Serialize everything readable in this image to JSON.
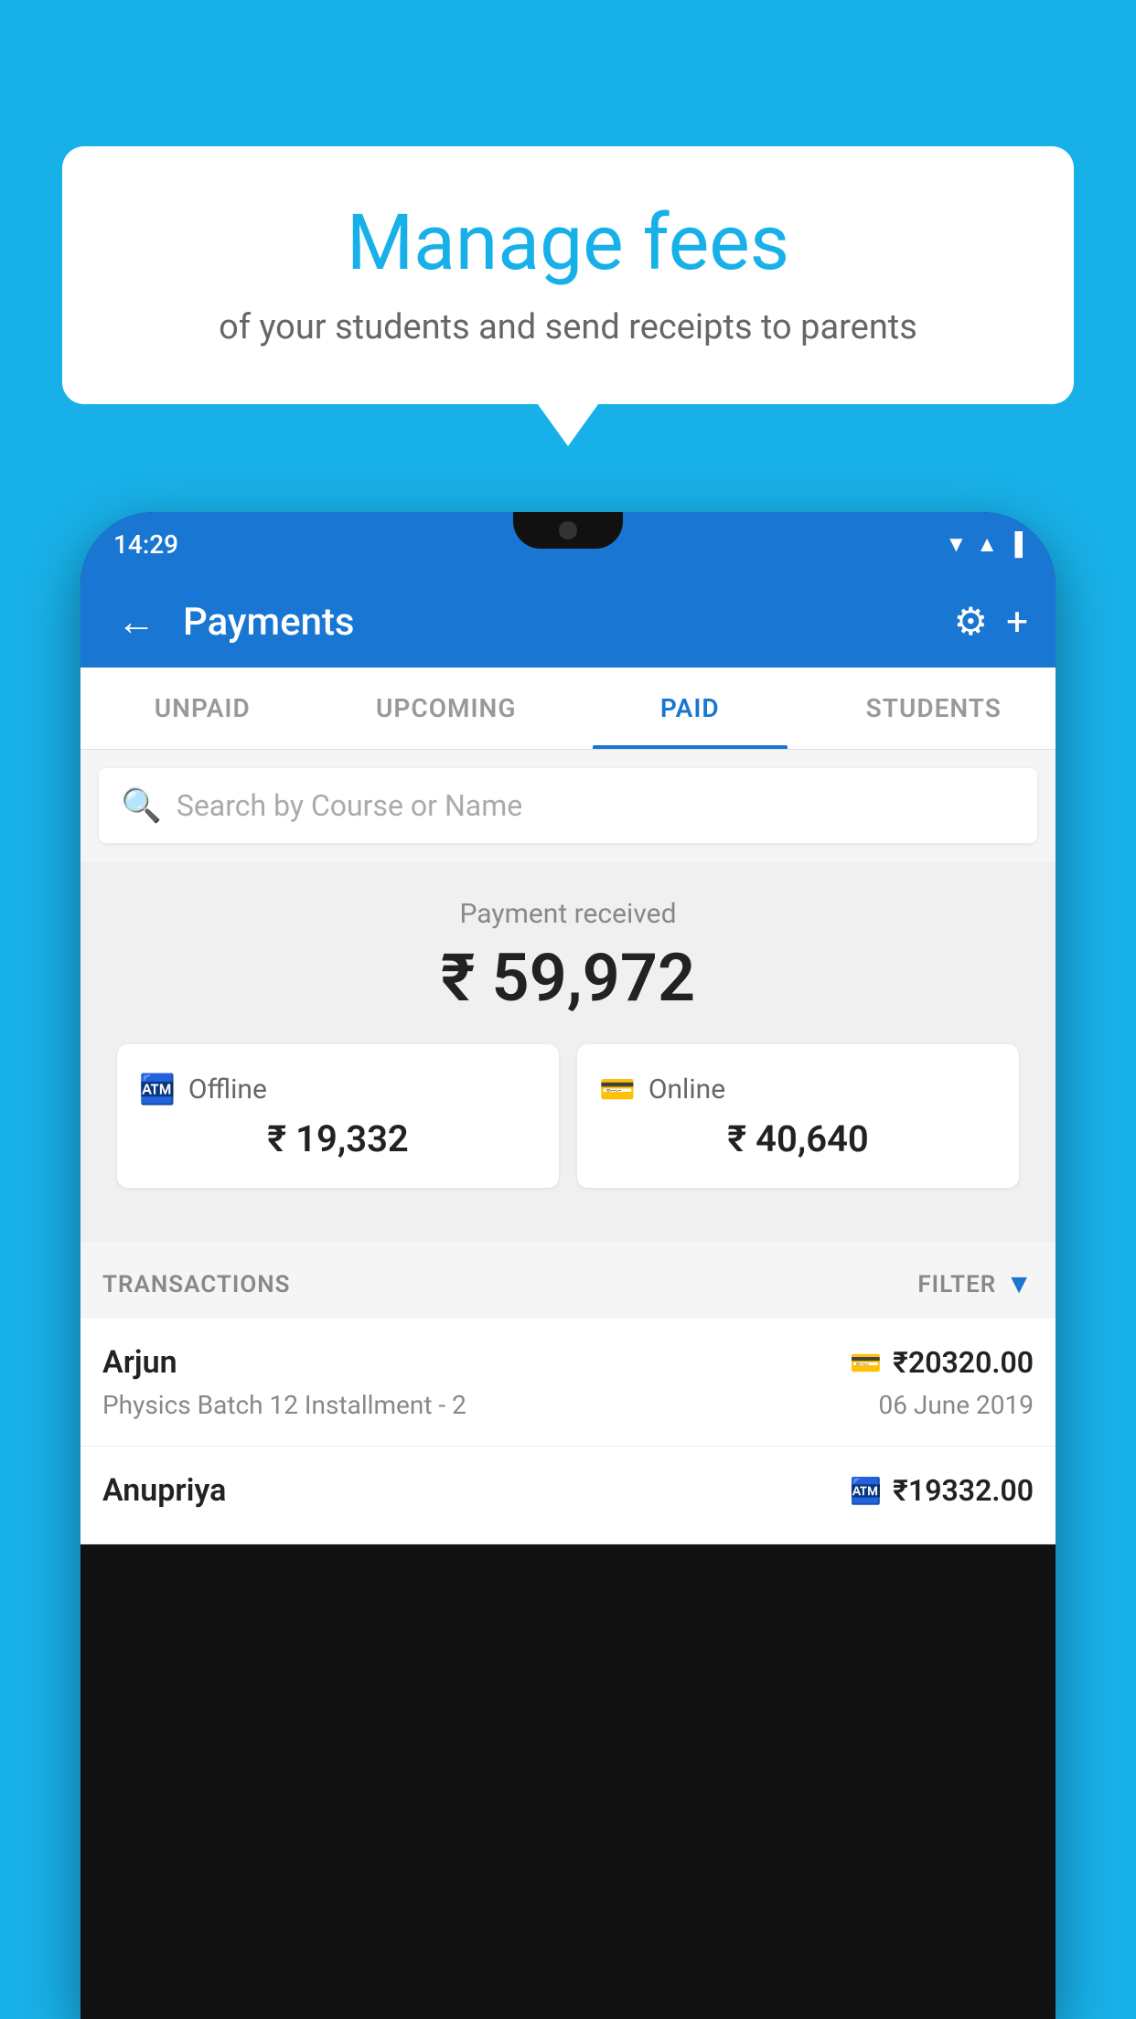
{
  "background_color": "#18B0E8",
  "bubble": {
    "title": "Manage fees",
    "subtitle": "of your students and send receipts to parents"
  },
  "status_bar": {
    "time": "14:29",
    "icons": [
      "▼",
      "▲",
      "▐"
    ]
  },
  "app_bar": {
    "title": "Payments",
    "back_label": "←",
    "settings_label": "⚙",
    "add_label": "+"
  },
  "tabs": [
    {
      "label": "UNPAID",
      "active": false
    },
    {
      "label": "UPCOMING",
      "active": false
    },
    {
      "label": "PAID",
      "active": true
    },
    {
      "label": "STUDENTS",
      "active": false
    }
  ],
  "search": {
    "placeholder": "Search by Course or Name"
  },
  "payment_received": {
    "label": "Payment received",
    "amount": "₹ 59,972"
  },
  "payment_cards": [
    {
      "type": "Offline",
      "amount": "₹ 19,332",
      "icon": "💳"
    },
    {
      "type": "Online",
      "amount": "₹ 40,640",
      "icon": "💳"
    }
  ],
  "transactions_label": "TRANSACTIONS",
  "filter_label": "FILTER",
  "transactions": [
    {
      "name": "Arjun",
      "course": "Physics Batch 12 Installment - 2",
      "amount": "₹20320.00",
      "date": "06 June 2019",
      "type_icon": "💳"
    },
    {
      "name": "Anupriya",
      "course": "",
      "amount": "₹19332.00",
      "date": "",
      "type_icon": "💷"
    }
  ]
}
